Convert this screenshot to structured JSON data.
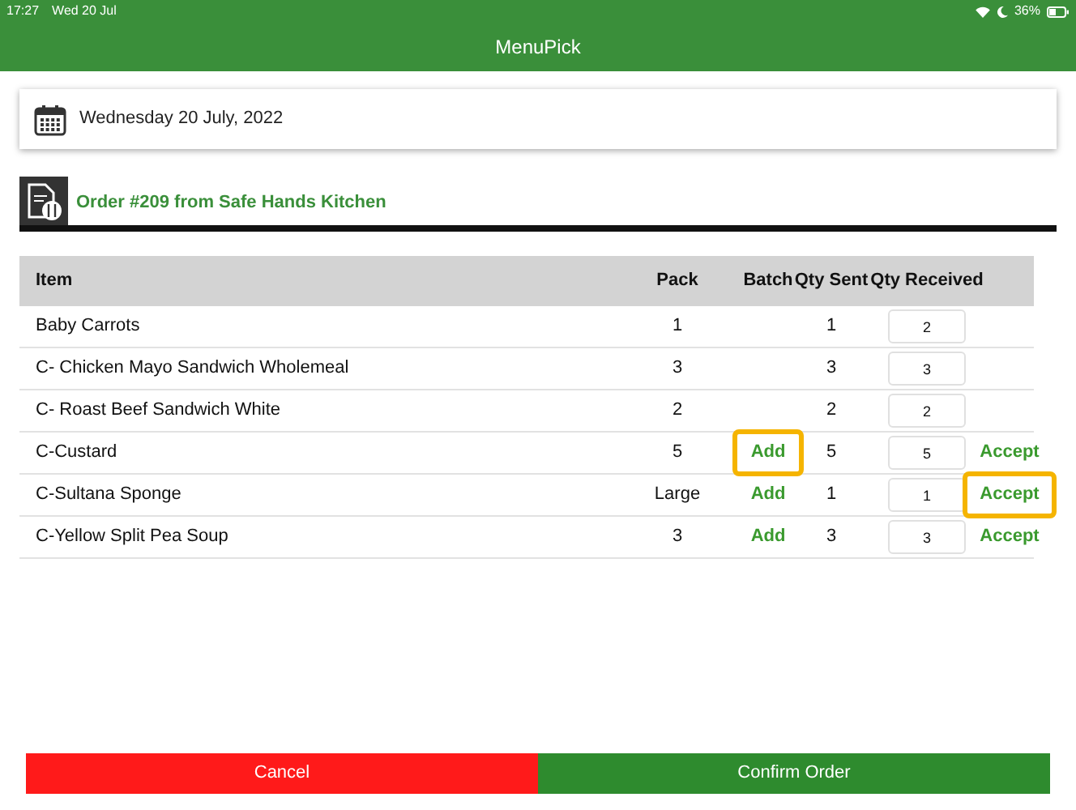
{
  "status_bar": {
    "time": "17:27",
    "date": "Wed 20 Jul",
    "battery": "36%"
  },
  "header": {
    "title": "MenuPick"
  },
  "date_card": {
    "date": "Wednesday 20 July, 2022"
  },
  "order": {
    "title": "Order #209 from Safe Hands Kitchen"
  },
  "table": {
    "columns": [
      "Item",
      "Pack",
      "Batch",
      "Qty Sent",
      "Qty Received"
    ],
    "rows": [
      {
        "item": "Baby Carrots",
        "pack": "1",
        "qty_sent": "1",
        "qty_received": "2"
      },
      {
        "item": "C- Chicken Mayo Sandwich Wholemeal",
        "pack": "3",
        "qty_sent": "3",
        "qty_received": "3"
      },
      {
        "item": "C- Roast Beef Sandwich White",
        "pack": "2",
        "qty_sent": "2",
        "qty_received": "2"
      },
      {
        "item": "C-Custard",
        "pack": "5",
        "batch": {
          "label": "Add",
          "highlighted": true
        },
        "qty_sent": "5",
        "qty_received": "5",
        "accept": {
          "label": "Accept",
          "highlighted": false
        }
      },
      {
        "item": "C-Sultana Sponge",
        "pack": "Large",
        "batch": {
          "label": "Add",
          "highlighted": false
        },
        "qty_sent": "1",
        "qty_received": "1",
        "accept": {
          "label": "Accept",
          "highlighted": true
        }
      },
      {
        "item": "C-Yellow Split Pea Soup",
        "pack": "3",
        "batch": {
          "label": "Add",
          "highlighted": false
        },
        "qty_sent": "3",
        "qty_received": "3",
        "accept": {
          "label": "Accept",
          "highlighted": false
        }
      }
    ]
  },
  "buttons": [
    {
      "label": "Cancel",
      "kind": "cancel"
    },
    {
      "label": "Confirm Order",
      "kind": "confirm"
    }
  ]
}
